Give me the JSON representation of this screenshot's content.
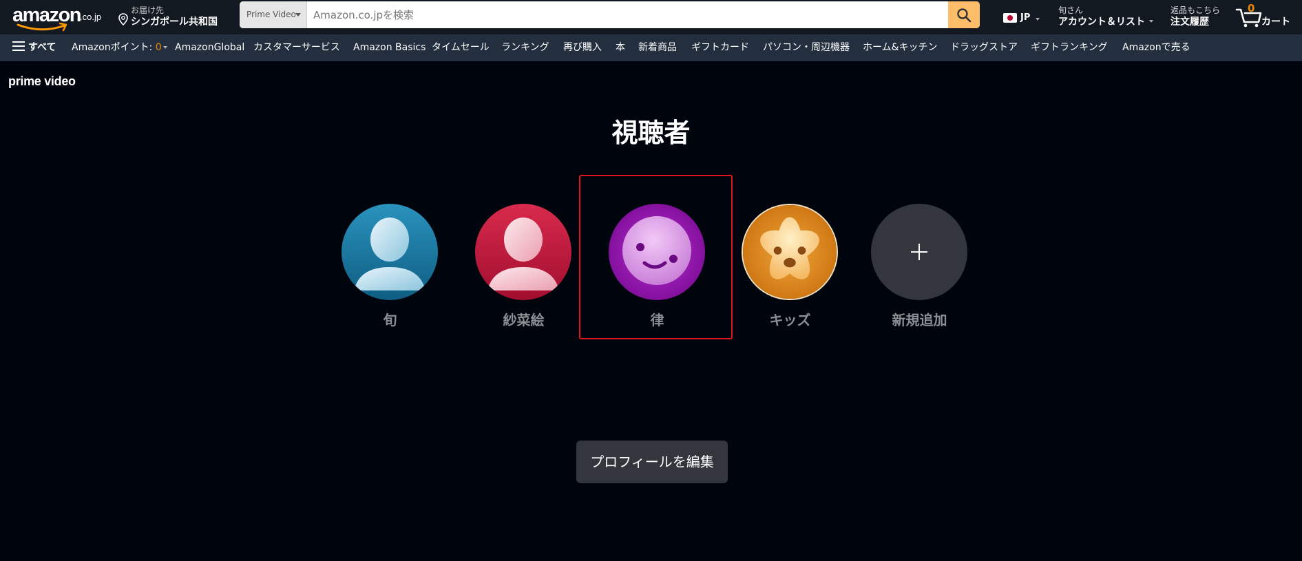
{
  "header": {
    "logo_text": "amazon",
    "logo_tld": ".co.jp",
    "deliver_line1": "お届け先",
    "deliver_line2": "シンガポール共和国",
    "search_category": "Prime Video",
    "search_placeholder": "Amazon.co.jpを検索",
    "lang_code": "JP",
    "account_line1": "旬さん",
    "account_line2": "アカウント＆リスト",
    "orders_line1": "返品もこちら",
    "orders_line2": "注文履歴",
    "cart_count": "0",
    "cart_label": "カート"
  },
  "subnav": {
    "all_label": "すべて",
    "points_label": "Amazonポイント: ",
    "points_value": "0",
    "items": [
      "AmazonGlobal",
      "カスタマーサービス",
      "Amazon Basics",
      "タイムセール",
      "ランキング",
      "再び購入",
      "本",
      "新着商品",
      "ギフトカード",
      "パソコン・周辺機器",
      "ホーム&キッチン",
      "ドラッグストア",
      "ギフトランキング",
      "Amazonで売る"
    ]
  },
  "main": {
    "brand": "prime video",
    "title": "視聴者",
    "profiles": [
      {
        "name": "旬",
        "avatar": "person-icon",
        "color": "#1b7fa8"
      },
      {
        "name": "紗菜絵",
        "avatar": "person-icon",
        "color": "#c8193c"
      },
      {
        "name": "律",
        "avatar": "smiley-face-icon",
        "color": "#9a15b5"
      },
      {
        "name": "キッズ",
        "avatar": "star-face-icon",
        "color": "#e38a1c"
      }
    ],
    "add_label": "新規追加",
    "edit_label": "プロフィールを編集"
  },
  "colors": {
    "nav_bg": "#131921",
    "subnav_bg": "#232f3e",
    "page_bg": "#00050d",
    "search_button": "#febd69",
    "accent_orange": "#f08804",
    "selection_border": "#e0141e"
  }
}
